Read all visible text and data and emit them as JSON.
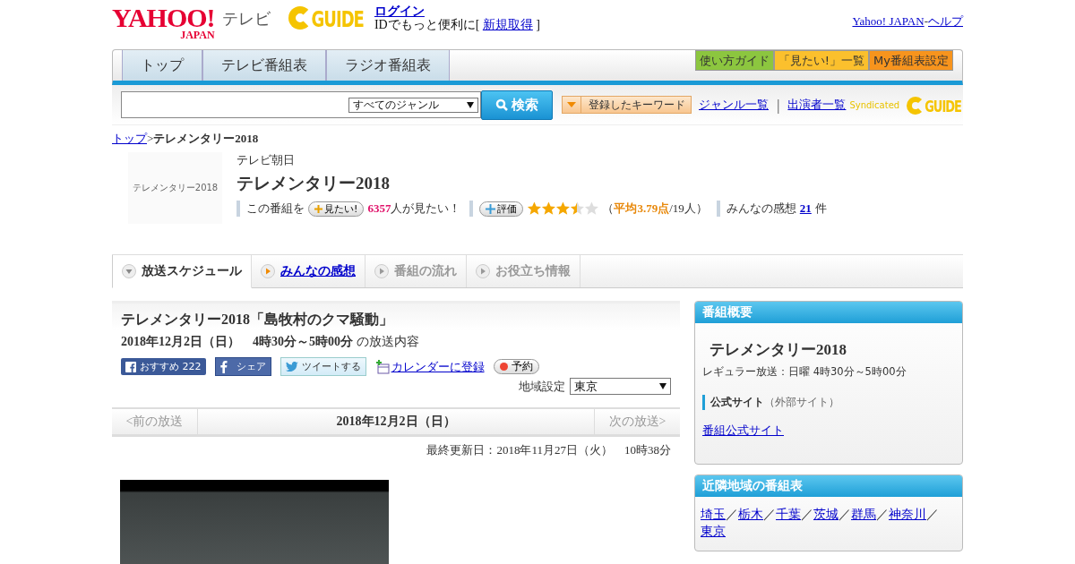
{
  "header": {
    "logo_main": "YAHOO!",
    "logo_sub": "JAPAN",
    "logo_section": "テレビ",
    "guide_logo": "GUIDE",
    "login": "ログイン",
    "id_prompt": "IDでもっと便利に[",
    "register": "新規取得",
    "id_close": "]",
    "top_links": [
      "Yahoo! JAPAN",
      "ヘルプ"
    ],
    "top_sep": "-"
  },
  "nav": {
    "tabs": [
      {
        "label": "トップ",
        "selected": false
      },
      {
        "label": "テレビ番組表",
        "selected": false
      },
      {
        "label": "ラジオ番組表",
        "selected": false
      }
    ],
    "buttons": [
      {
        "label": "使い方ガイド",
        "color": "#8cc63f"
      },
      {
        "label": "「見たい!」一覧",
        "color": "#fbc02d"
      },
      {
        "label": "My番組表設定",
        "color": "#f7941d"
      }
    ]
  },
  "search": {
    "genre": "すべてのジャンル",
    "button": "検索",
    "keyword_button": "登録したキーワード",
    "links": [
      "ジャンル一覧",
      "出演者一覧"
    ],
    "sep": "|",
    "syndicated": "Syndicated",
    "guide_logo": "GUIDE"
  },
  "breadcrumb": {
    "link": "トップ",
    "sep": ">",
    "current": "テレメンタリー2018"
  },
  "program": {
    "thumb_text": "テレメンタリー2018",
    "channel": "テレビ朝日",
    "title": "テレメンタリー2018",
    "want_prefix": "この番組を",
    "want_button": "見たい!",
    "want_count": "6357",
    "want_suffix": "人が見たい！",
    "rate_button": "評価",
    "stars": 3.5,
    "rating_text": "（**平均3.79点**/19人）",
    "impressions_label": "みんなの感想",
    "impressions_count": "21",
    "impressions_unit": "件"
  },
  "tabs": [
    {
      "label": "放送スケジュール",
      "selected": true,
      "disabled": false
    },
    {
      "label": "みんなの感想",
      "selected": false,
      "disabled": false
    },
    {
      "label": "番組の流れ",
      "selected": false,
      "disabled": true
    },
    {
      "label": "お役立ち情報",
      "selected": false,
      "disabled": true
    }
  ],
  "episode": {
    "title": "テレメンタリー2018「島牧村のクマ騒動」",
    "airtime": "2018年12月2日（日）　4時30分～5時00分",
    "airtime_suffix": "の放送内容",
    "actions": [
      {
        "kind": "fb-recommend",
        "label": "おすすめ",
        "count": "222"
      },
      {
        "kind": "fb-share",
        "label": "シェア"
      },
      {
        "kind": "tweet",
        "label": "ツイートする"
      },
      {
        "kind": "calendar",
        "label": "カレンダーに登録"
      },
      {
        "kind": "reserve",
        "label": "予約"
      }
    ],
    "region_label": "地域設定",
    "region": "東京"
  },
  "pager": {
    "prev": "<前の放送",
    "date": "2018年12月2日（日）",
    "next": "次の放送>"
  },
  "updated": "最終更新日：2018年11月27日（火）　10時38分",
  "overview": {
    "heading": "番組概要",
    "title": "テレメンタリー2018",
    "regular": "レギュラー放送：日曜 4時30分～5時00分",
    "site_label": "公式サイト",
    "site_note": "（外部サイト）",
    "site_link": "番組公式サイト"
  },
  "nearby": {
    "heading": "近隣地域の番組表",
    "regions": [
      "埼玉",
      "栃木",
      "千葉",
      "茨城",
      "群馬",
      "神奈川",
      "東京"
    ],
    "sep": "／"
  }
}
